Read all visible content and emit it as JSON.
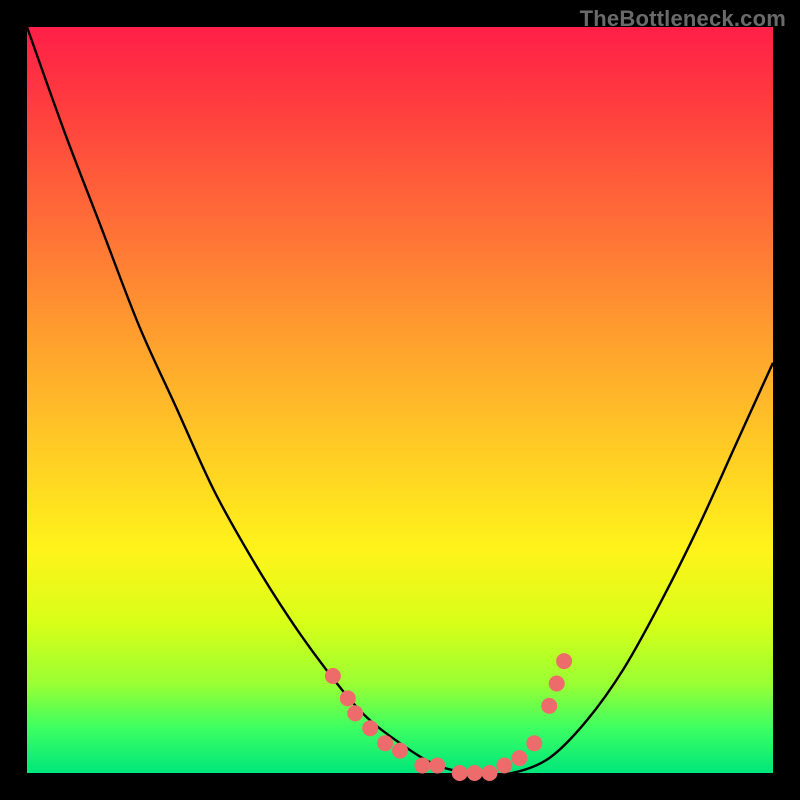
{
  "watermark": "TheBottleneck.com",
  "colors": {
    "page_bg": "#000000",
    "gradient_top": "#ff1f48",
    "gradient_bottom": "#00e67a",
    "curve_stroke": "#000000",
    "marker_fill": "#ee6b6b"
  },
  "chart_data": {
    "type": "line",
    "title": "",
    "xlabel": "",
    "ylabel": "",
    "x": [
      0.0,
      0.05,
      0.1,
      0.15,
      0.2,
      0.25,
      0.3,
      0.35,
      0.4,
      0.45,
      0.5,
      0.55,
      0.6,
      0.65,
      0.7,
      0.75,
      0.8,
      0.85,
      0.9,
      0.95,
      1.0
    ],
    "values": [
      1.0,
      0.86,
      0.73,
      0.6,
      0.49,
      0.38,
      0.29,
      0.21,
      0.14,
      0.08,
      0.04,
      0.01,
      0.0,
      0.0,
      0.02,
      0.07,
      0.14,
      0.23,
      0.33,
      0.44,
      0.55
    ],
    "xlim": [
      0,
      1
    ],
    "ylim": [
      0,
      1
    ],
    "markers": [
      {
        "x": 0.41,
        "y": 0.13
      },
      {
        "x": 0.43,
        "y": 0.1
      },
      {
        "x": 0.44,
        "y": 0.08
      },
      {
        "x": 0.46,
        "y": 0.06
      },
      {
        "x": 0.48,
        "y": 0.04
      },
      {
        "x": 0.5,
        "y": 0.03
      },
      {
        "x": 0.53,
        "y": 0.01
      },
      {
        "x": 0.55,
        "y": 0.01
      },
      {
        "x": 0.58,
        "y": 0.0
      },
      {
        "x": 0.6,
        "y": 0.0
      },
      {
        "x": 0.62,
        "y": 0.0
      },
      {
        "x": 0.64,
        "y": 0.01
      },
      {
        "x": 0.66,
        "y": 0.02
      },
      {
        "x": 0.68,
        "y": 0.04
      },
      {
        "x": 0.7,
        "y": 0.09
      },
      {
        "x": 0.71,
        "y": 0.12
      },
      {
        "x": 0.72,
        "y": 0.15
      }
    ]
  }
}
